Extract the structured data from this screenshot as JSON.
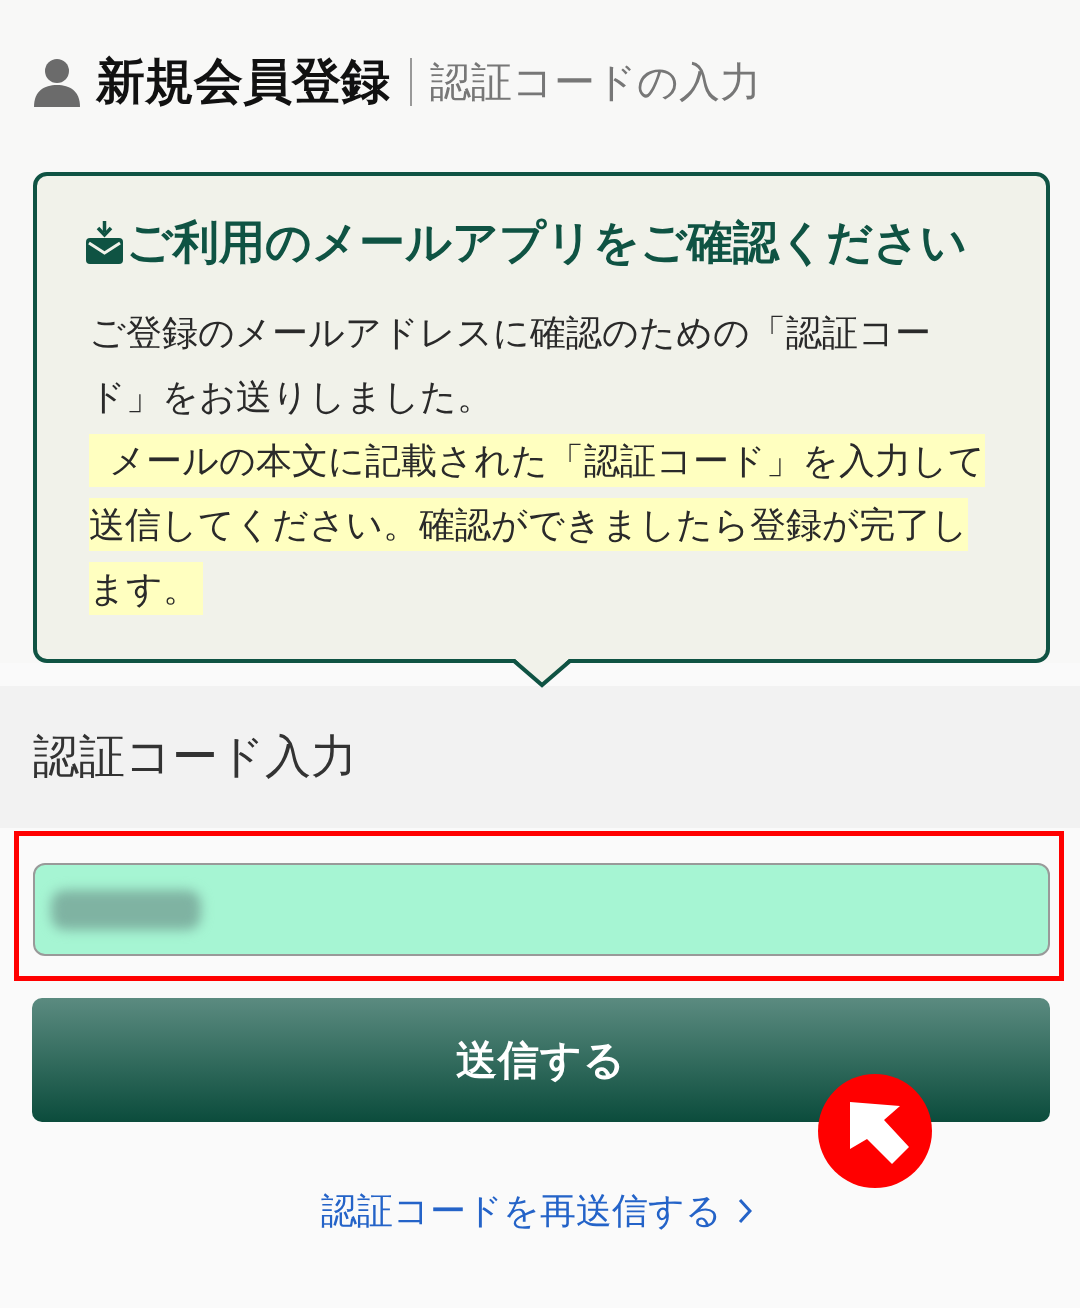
{
  "header": {
    "title": "新規会員登録",
    "subtitle": "認証コードの入力"
  },
  "notice": {
    "title": "ご利用のメールアプリをご確認ください",
    "message": "ご登録のメールアドレスに確認のための「認証コード」をお送りしました。",
    "highlight": "メールの本文に記載された「認証コード」を入力して送信してください。確認ができましたら登録が完了します。"
  },
  "code_section": {
    "label": "認証コード入力"
  },
  "code_input": {
    "blurred_value": true
  },
  "submit_button": {
    "label": "送信する"
  },
  "resend_link": {
    "label": "認証コードを再送信する"
  }
}
